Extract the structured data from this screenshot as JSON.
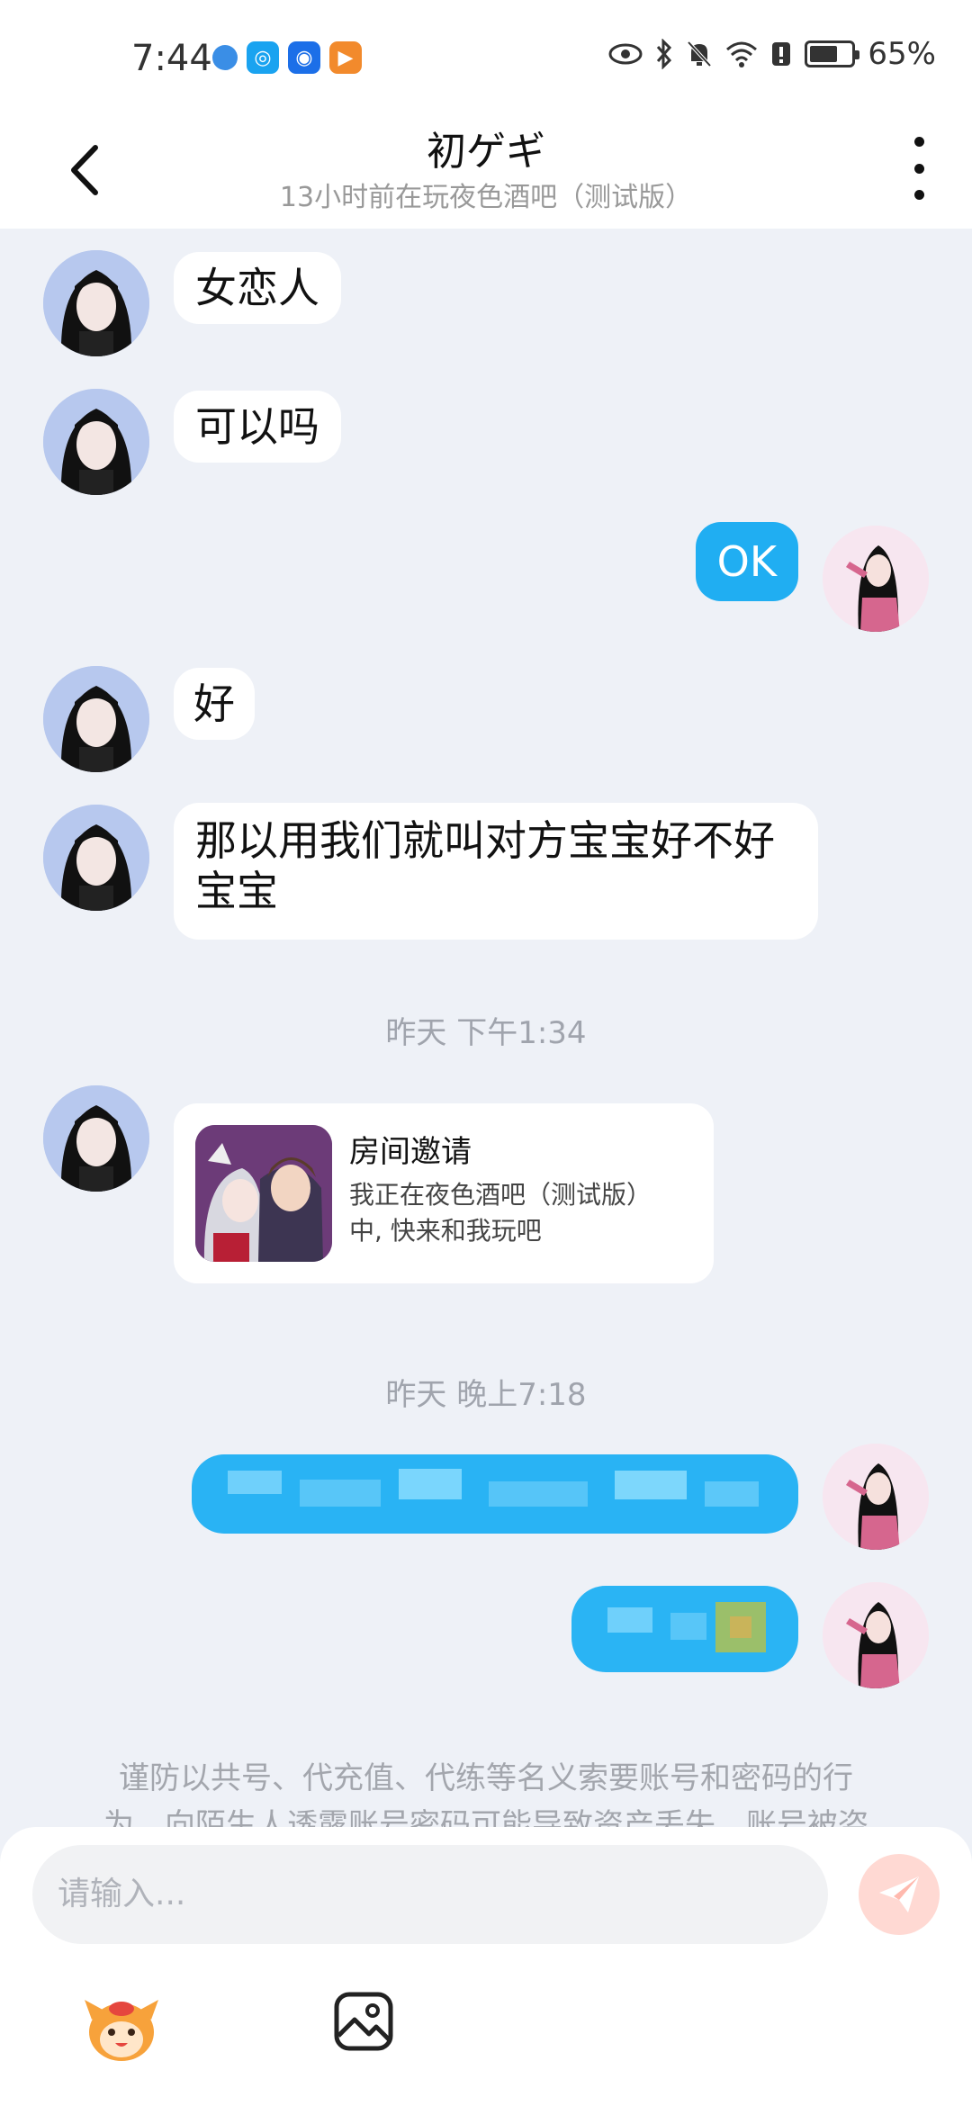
{
  "status_bar": {
    "time": "7:44",
    "battery": "65%"
  },
  "header": {
    "title": "初ゲギ",
    "subtitle": "13小时前在玩夜色酒吧（测试版）"
  },
  "messages": [
    {
      "side": "in",
      "text": "女恋人"
    },
    {
      "side": "in",
      "text": "可以吗"
    },
    {
      "side": "out",
      "text": "OK"
    },
    {
      "side": "in",
      "text": "好"
    },
    {
      "side": "in",
      "line1": "那以用我们就叫对方宝宝好不好",
      "line2": "宝宝"
    }
  ],
  "timestamps": [
    "昨天 下午1:34",
    "昨天 晚上7:18"
  ],
  "invite_card": {
    "title": "房间邀请",
    "desc_line1": "我正在夜色酒吧（测试版）",
    "desc_line2": "中, 快来和我玩吧"
  },
  "notice": {
    "line1": "谨防以共号、代充值、代练等名义索要账号和密码的行",
    "line2": "为，向陌生人透露账号密码可能导致资产丢失，账号被盗"
  },
  "input": {
    "placeholder": "请输入..."
  },
  "icons": {
    "back": "back-arrow-icon",
    "more": "more-vertical-icon",
    "send": "send-icon",
    "emoji": "mascot-icon",
    "image": "image-icon"
  },
  "colors": {
    "accent": "#20aef2",
    "background": "#eef1f7",
    "send_disabled": "#ffd9d3"
  }
}
